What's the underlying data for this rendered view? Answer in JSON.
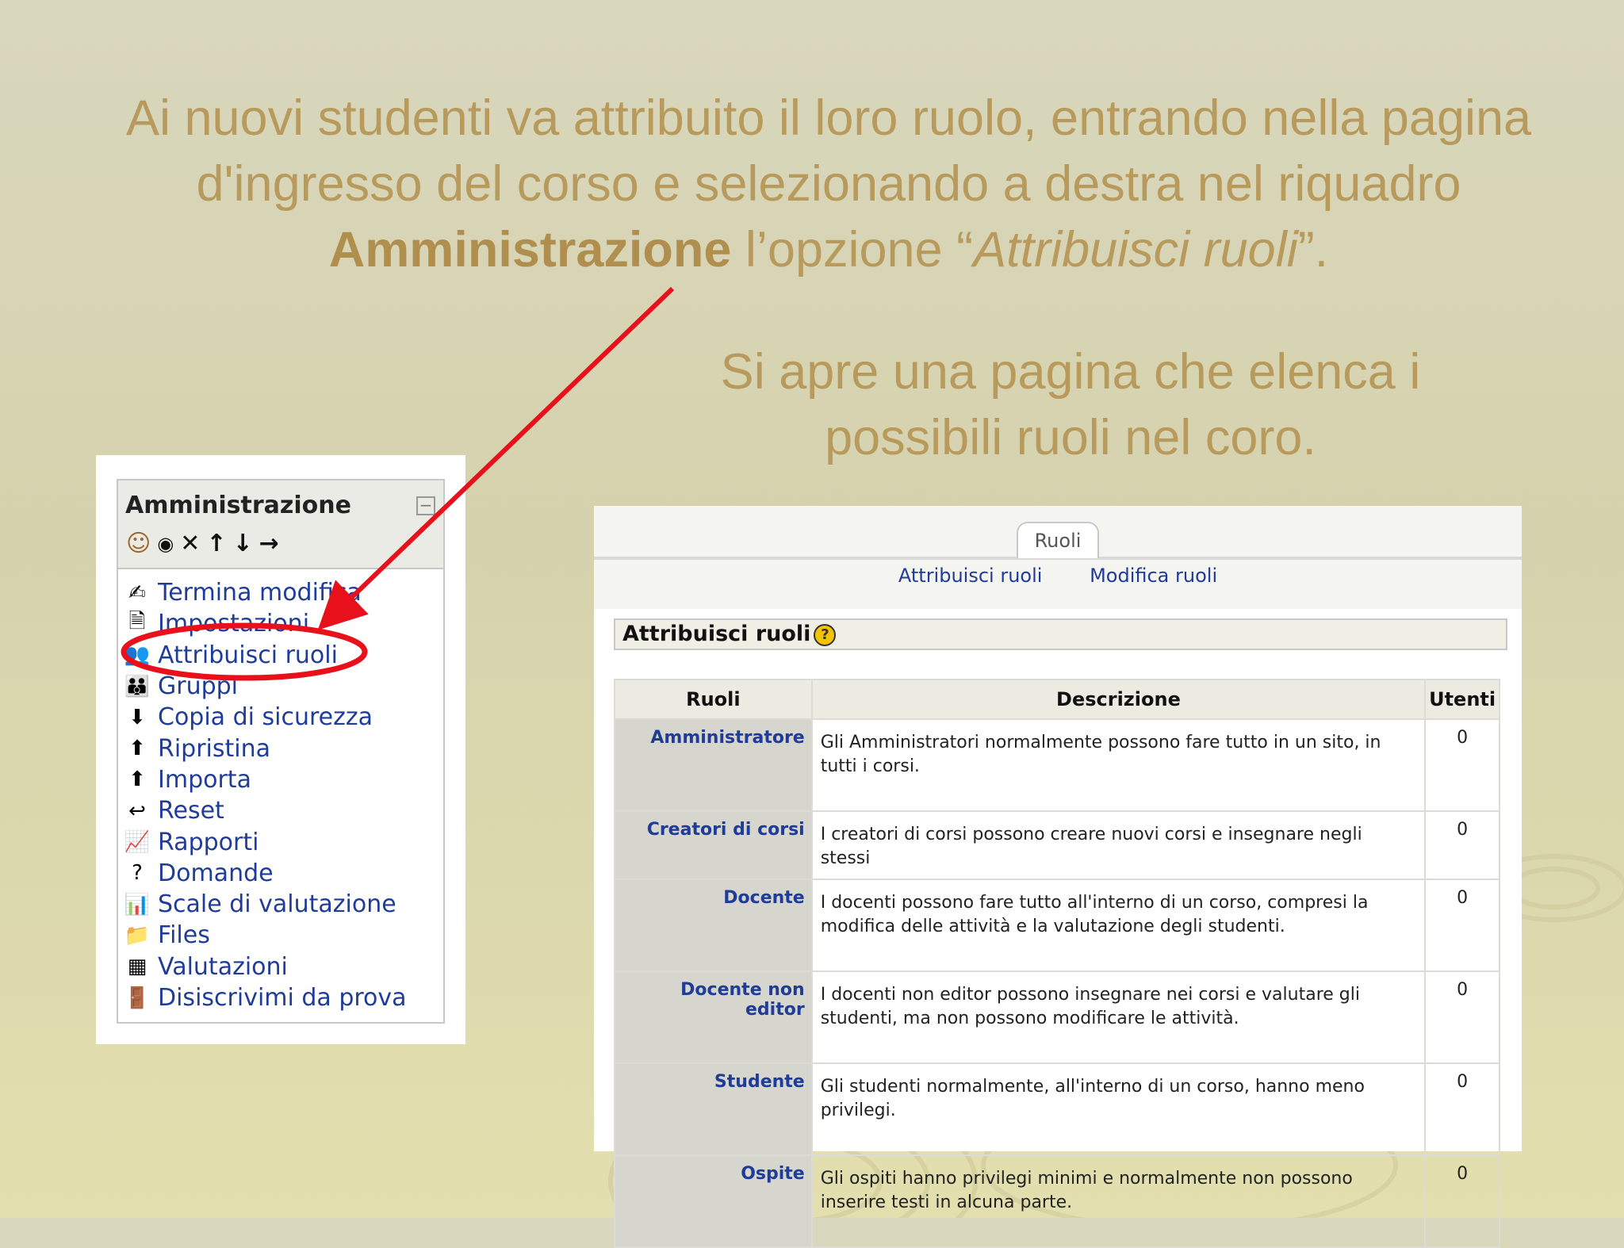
{
  "slide": {
    "headline": {
      "part1": "Ai nuovi studenti va attribuito il loro ruolo, entrando nella pagina d'ingresso del corso e selezionando a destra nel riquadro ",
      "bold": "Amministrazione",
      "part2": " l’opzione “",
      "italic": "Attribuisci ruoli",
      "part3": "”."
    },
    "subtitle": "Si apre una pagina che elenca i possibili ruoli nel coro."
  },
  "admin_block": {
    "title": "Amministrazione",
    "collapse_symbol": "−",
    "tools": [
      "assign-roles-icon",
      "eye-icon",
      "delete-icon",
      "move-up-icon",
      "move-down-icon",
      "move-right-icon"
    ],
    "items": [
      {
        "label": "Termina modifica",
        "icon": "edit-icon",
        "glyph": "✍"
      },
      {
        "label": "Impostazioni",
        "icon": "settings-document-icon",
        "glyph": "🗎"
      },
      {
        "label": "Attribuisci ruoli",
        "icon": "roles-icon",
        "glyph": "👥"
      },
      {
        "label": "Gruppi",
        "icon": "groups-icon",
        "glyph": "👪"
      },
      {
        "label": "Copia di sicurezza",
        "icon": "backup-icon",
        "glyph": "⬇"
      },
      {
        "label": "Ripristina",
        "icon": "restore-icon",
        "glyph": "⬆"
      },
      {
        "label": "Importa",
        "icon": "import-icon",
        "glyph": "⬆"
      },
      {
        "label": "Reset",
        "icon": "reset-icon",
        "glyph": "↩"
      },
      {
        "label": "Rapporti",
        "icon": "reports-icon",
        "glyph": "📈"
      },
      {
        "label": "Domande",
        "icon": "questions-icon",
        "glyph": "?"
      },
      {
        "label": "Scale di valutazione",
        "icon": "scales-icon",
        "glyph": "📊"
      },
      {
        "label": "Files",
        "icon": "folder-icon",
        "glyph": "📁"
      },
      {
        "label": "Valutazioni",
        "icon": "grades-icon",
        "glyph": "▦"
      },
      {
        "label": "Disiscrivimi da prova",
        "icon": "unenrol-icon",
        "glyph": "🚪"
      }
    ]
  },
  "roles_page": {
    "tab": "Ruoli",
    "subtabs": [
      "Attribuisci ruoli",
      "Modifica ruoli"
    ],
    "heading": "Attribuisci ruoli",
    "help_symbol": "?",
    "columns": [
      "Ruoli",
      "Descrizione",
      "Utenti"
    ],
    "rows": [
      {
        "role": "Amministratore",
        "description": "Gli Amministratori normalmente possono fare tutto in un sito, in tutti i corsi.",
        "users": "0"
      },
      {
        "role": "Creatori di corsi",
        "description": "I creatori di corsi possono creare nuovi corsi e insegnare negli stessi",
        "users": "0"
      },
      {
        "role": "Docente",
        "description": "I docenti possono fare tutto all'interno di un corso, compresi la modifica delle attività e la valutazione degli studenti.",
        "users": "0"
      },
      {
        "role": "Docente non editor",
        "description": "I docenti non editor possono insegnare nei corsi e valutare gli studenti, ma non possono modificare le attività.",
        "users": "0"
      },
      {
        "role": "Studente",
        "description": "Gli studenti normalmente, all'interno di un corso, hanno meno privilegi.",
        "users": "0"
      },
      {
        "role": "Ospite",
        "description": "Gli ospiti hanno privilegi minimi e normalmente non possono inserire testi in alcuna parte.",
        "users": "0"
      }
    ]
  },
  "colors": {
    "text_gold": "#b79a5c",
    "link_blue": "#1f3c99",
    "annotation_red": "#e8101a"
  }
}
